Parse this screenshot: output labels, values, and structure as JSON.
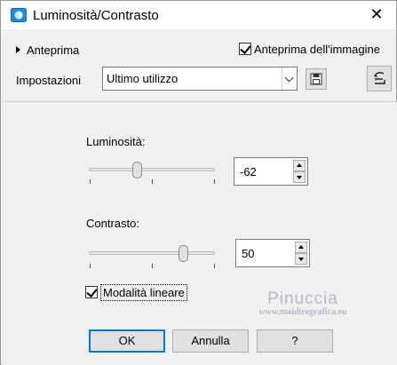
{
  "window": {
    "title": "Luminosità/Contrasto",
    "close_glyph": "✕"
  },
  "top": {
    "preview_toggle": "Anteprima",
    "preview_image_label": "Anteprima dell'immagine",
    "preview_image_checked": true
  },
  "settings": {
    "label": "Impostazioni",
    "preset_value": "Ultimo utilizzo"
  },
  "brightness": {
    "label": "Luminosità:",
    "value": "-62",
    "min": -255,
    "max": 255,
    "numeric": -62
  },
  "contrast": {
    "label": "Contrasto:",
    "value": "50",
    "min": -100,
    "max": 100,
    "numeric": 50
  },
  "linear_mode": {
    "label": "Modalità lineare",
    "checked": true
  },
  "watermark": {
    "name": "Pinuccia",
    "url": "www.maidiregrafica.eu"
  },
  "buttons": {
    "ok": "OK",
    "cancel": "Annulla",
    "help": "?"
  },
  "colors": {
    "accent": "#0078d7",
    "icon_blue": "#1e8fd6"
  }
}
